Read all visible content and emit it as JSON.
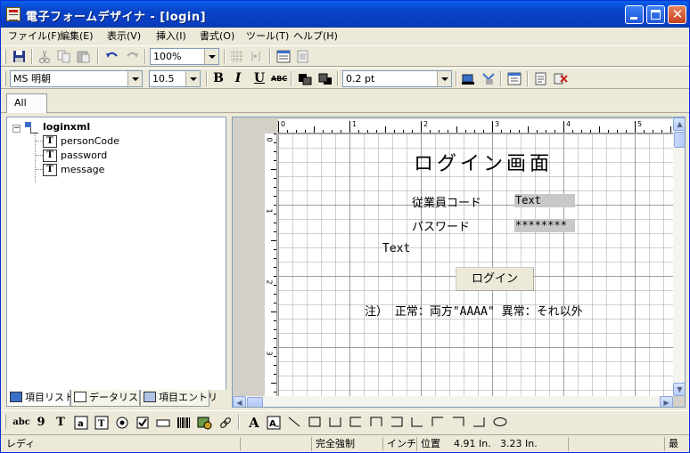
{
  "window": {
    "title": "電子フォームデザイナ - [login]"
  },
  "menu": [
    "ファイル(F)",
    "編集(E)",
    "表示(V)",
    "挿入(I)",
    "書式(O)",
    "ツール(T)",
    "ヘルプ(H)"
  ],
  "toolbar1": {
    "zoom": "100%"
  },
  "toolbar2": {
    "font_name": "MS 明朝",
    "font_size": "10.5",
    "bold": "B",
    "italic": "I",
    "underline": "U",
    "strike": "ABC",
    "line_width": "0.2 pt"
  },
  "tabs": {
    "all": "All"
  },
  "tree": {
    "root": "loginxml",
    "children": [
      "personCode",
      "password",
      "message"
    ],
    "node_icon": "T",
    "expander": "−"
  },
  "left_tabs": [
    "項目リスト",
    "データリスト",
    "項目エントリ"
  ],
  "ruler": {
    "h_labels": [
      "0",
      "1",
      "2",
      "3",
      "4",
      "5"
    ],
    "v_labels": [
      "0",
      "1",
      "2",
      "3"
    ]
  },
  "form": {
    "title": "ログイン画面",
    "employee_label": "従業員コード",
    "employee_value": "Text",
    "password_label": "パスワード",
    "password_value": "********",
    "message_value": "Text",
    "login_button": "ログイン",
    "note": "注） 正常：両方\"AAAA\" 異常：それ以外"
  },
  "palette": {
    "abc": "abc",
    "nine": "9",
    "T": "T",
    "A": "A"
  },
  "status": {
    "ready": "レディ",
    "mode": "完全強制",
    "unit": "インチ",
    "pos_label": "位置",
    "pos_x": "4.91 In.",
    "pos_y": "3.23 In.",
    "trailing": "最"
  },
  "colors": {
    "titlebar": "#0a3dbf",
    "field_bg": "#c8c8c8"
  }
}
